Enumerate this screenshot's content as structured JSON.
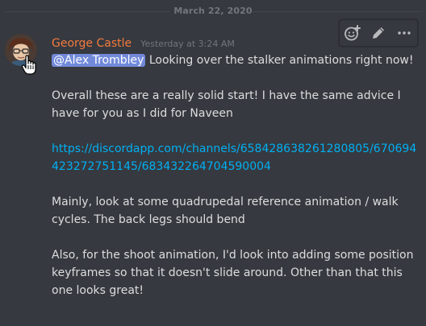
{
  "date_divider": {
    "text": "March 22, 2020"
  },
  "toolbar": {
    "icons": [
      "add-reaction-icon",
      "edit-pencil-icon",
      "more-options-icon"
    ]
  },
  "message": {
    "author": "George Castle",
    "timestamp": "Yesterday at 3:24 AM",
    "mention": "@Alex Trombley",
    "line1_rest": " Looking over the stalker animations right now!",
    "para2": "Overall these are a really solid start! I have the same advice I have for you as I did for Naveen",
    "link": "https://discordapp.com/channels/658428638261280805/670694423272751145/683432264704590004",
    "para4": "Mainly, look at some quadrupedal reference animation / walk cycles. The back legs should bend",
    "para5": "Also, for the shoot animation, I'd look into adding some position keyframes so that it doesn't slide around. Other than that this one looks great!"
  },
  "colors": {
    "background": "#36393f",
    "username": "#f47b3e",
    "mention_bg": "#7289da",
    "link": "#00b0f4",
    "text": "#dcddde",
    "muted": "#72767d"
  }
}
